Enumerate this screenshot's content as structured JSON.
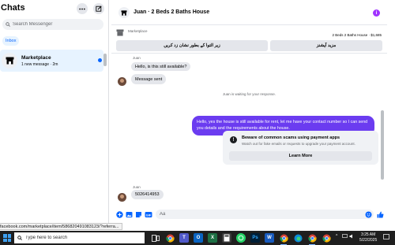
{
  "sidebar": {
    "title": "Chats",
    "search_placeholder": "Search Messenger",
    "filter": "Inbox",
    "conversation": {
      "name": "Marketplace",
      "preview": "1 new message · 2m"
    }
  },
  "chat": {
    "title": "Juan · 2 Beds 2 Baths House",
    "listing": {
      "source_label": "Marketplace",
      "price_line": "2 Beds 2 Baths House · $1,685"
    },
    "quick_replies": [
      "زیر التوا کے بطور نشان زد کریں",
      "مزید آپشنز"
    ],
    "messages": {
      "sender_1": "Juan",
      "msg_1": "Hello, is this still available?",
      "msg_2": "Message sent",
      "system": "Juan is waiting for your response.",
      "outgoing": "Hello, yes the house is still available for rent, let me have your contact number so I can send you details and the requirements about the house.",
      "sender_2": "Juan",
      "msg_3": "5026414953"
    },
    "scam_card": {
      "title": "Beware of common scams using payment apps",
      "subtitle": "Watch out for fake emails or requests to upgrade your payment account.",
      "button": "Learn More"
    },
    "composer_placeholder": "Aa"
  },
  "status_url": "facebook.com/marketplace/item/586820491083123/?referra...",
  "taskbar": {
    "search_placeholder": "Type here to search",
    "time": "3:25 AM",
    "date": "5/22/2025",
    "apps": [
      "task-view",
      "chrome",
      "teams",
      "outlook",
      "excel",
      "calculator",
      "whatsapp",
      "photoshop",
      "word",
      "chrome",
      "edge",
      "chrome",
      "chrome"
    ]
  },
  "colors": {
    "accent": "#0866ff",
    "outgoing_bubble": "#6b3cf0",
    "info": "#a033ff",
    "taskbar": "#1f1f1f"
  }
}
